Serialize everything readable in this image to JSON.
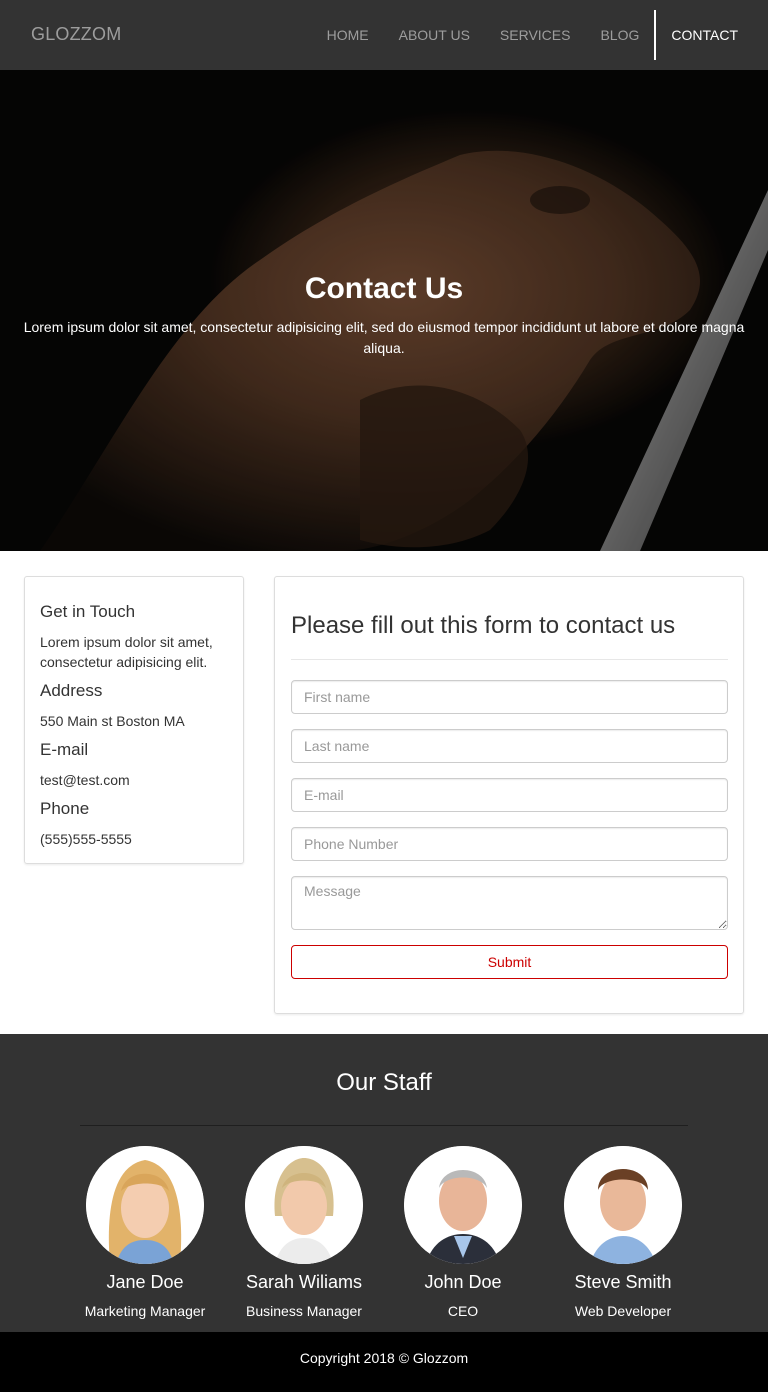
{
  "nav": {
    "brand": "GLOZZOM",
    "items": [
      {
        "label": "HOME"
      },
      {
        "label": "ABOUT US"
      },
      {
        "label": "SERVICES"
      },
      {
        "label": "BLOG"
      },
      {
        "label": "CONTACT"
      }
    ]
  },
  "hero": {
    "title": "Contact Us",
    "subtitle": "Lorem ipsum dolor sit amet, consectetur adipisicing elit, sed do eiusmod tempor incididunt ut labore et dolore magna aliqua."
  },
  "contact_info": {
    "title": "Get in Touch",
    "text": "Lorem ipsum dolor sit amet, consectetur adipisicing elit.",
    "address_heading": "Address",
    "address": "550 Main st Boston MA",
    "email_heading": "E-mail",
    "email": "test@test.com",
    "phone_heading": "Phone",
    "phone": "(555)555-5555"
  },
  "form": {
    "title": "Please fill out this form to contact us",
    "first_name_placeholder": "First name",
    "last_name_placeholder": "Last name",
    "email_placeholder": "E-mail",
    "phone_placeholder": "Phone Number",
    "message_placeholder": "Message",
    "submit_label": "Submit"
  },
  "staff": {
    "title": "Our Staff",
    "members": [
      {
        "name": "Jane Doe",
        "role": "Marketing Manager"
      },
      {
        "name": "Sarah Wiliams",
        "role": "Business Manager"
      },
      {
        "name": "John Doe",
        "role": "CEO"
      },
      {
        "name": "Steve Smith",
        "role": "Web Developer"
      }
    ]
  },
  "footer": {
    "text": "Copyright 2018 © Glozzom"
  },
  "colors": {
    "navbar_bg": "#333333",
    "accent_red": "#cc0000",
    "staff_bg": "#333333",
    "footer_bg": "#000000"
  }
}
